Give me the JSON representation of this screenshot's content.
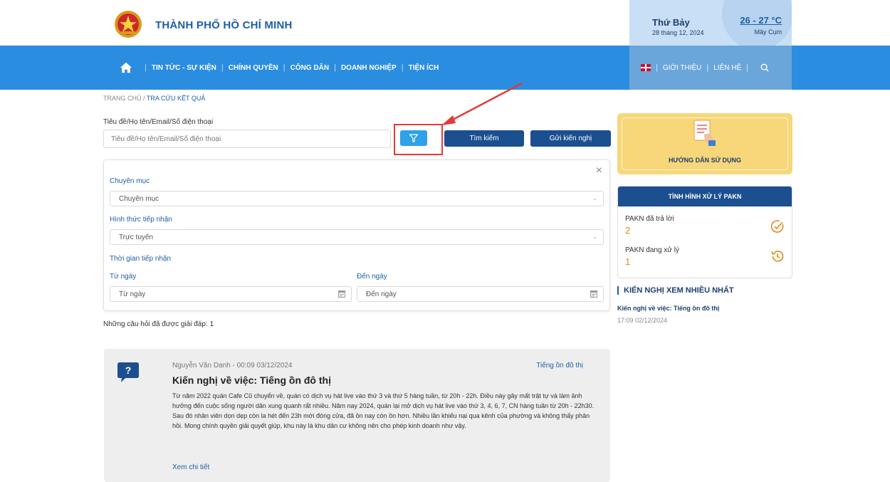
{
  "header": {
    "site_title": "THÀNH PHỐ HỒ CHÍ MINH",
    "weather": {
      "day": "Thứ Bảy",
      "date": "28 tháng 12, 2024",
      "temperature": "26 - 27 °C",
      "condition": "Mây Cụm"
    }
  },
  "nav": {
    "items": [
      {
        "label": "TIN TỨC - SỰ KIỆN"
      },
      {
        "label": "CHÍNH QUYỀN"
      },
      {
        "label": "CÔNG DÂN"
      },
      {
        "label": "DOANH NGHIỆP"
      },
      {
        "label": "TIỆN ÍCH"
      }
    ],
    "right": {
      "about": "GIỚI THIỆU",
      "contact": "LIÊN HỆ"
    }
  },
  "breadcrumb": {
    "home": "TRANG CHỦ /",
    "current": "TRA CỨU KẾT QUẢ"
  },
  "search": {
    "label": "Tiêu đề/Họ tên/Email/Số điện thoại",
    "placeholder": "Tiêu đề/Họ tên/Email/Số điện thoại",
    "search_button": "Tìm kiếm",
    "send_button": "Gửi kiến nghị"
  },
  "filter": {
    "close": "×",
    "category_label": "Chuyên mục",
    "category_value": "Chuyên mục",
    "method_label": "Hình thức tiếp nhận",
    "method_value": "Trực tuyến",
    "time_label": "Thời gian tiếp nhận",
    "from_label": "Từ ngày",
    "from_placeholder": "Từ ngày",
    "to_label": "Đến ngày",
    "to_placeholder": "Đến ngày"
  },
  "answered_text": "Những câu hỏi đã được giải đáp: 1",
  "question": {
    "author": "Nguyễn Văn Danh - 00:09 03/12/2024",
    "category": "Tiếng ồn đô thị",
    "title": "Kiến nghị về việc: Tiếng ồn đô thị",
    "body": "Từ năm 2022 quán Cafe Cũ chuyển về, quán có dịch vụ hát live vào thứ 3 và thứ 5 hàng tuần, từ 20h - 22h. Điều này gây mất trật tự và làm ảnh hưởng đến cuộc sống người dân xung quanh rất nhiều. Năm nay 2024, quán lại mở dịch vụ hát live vào thứ 3, 4, 6, 7, CN hàng tuần từ 20h - 22h30. Sau đó nhân viên dọn dẹp còn la hét đến 23h mới đóng cửa, đã ồn nay còn ồn hơn. Nhiều lần khiếu nại qua kênh của phường và không thấy phản hồi. Mong chính quyền giải quyết giúp, khu này là khu dân cư không nên cho phép kinh doanh như vậy.",
    "more": "Xem chi tiết"
  },
  "sidebar": {
    "guide": "HƯỚNG DẪN SỬ DỤNG",
    "status_title": "TÌNH HÌNH XỬ LÝ PAKN",
    "answered_label": "PAKN đã trả lời",
    "answered_value": "2",
    "processing_label": "PAKN đang xử lý",
    "processing_value": "1",
    "most_viewed_title": "KIẾN NGHỊ XEM NHIỀU NHẤT",
    "most_viewed_item": "Kiến nghị về việc: Tiếng ồn đô thị",
    "most_viewed_time": "17:09 02/12/2024"
  },
  "colors": {
    "nav_blue": "#2a8de0",
    "dark_blue": "#1c4f8f",
    "accent_orange": "#e08a17",
    "highlight_red": "#e53935"
  }
}
